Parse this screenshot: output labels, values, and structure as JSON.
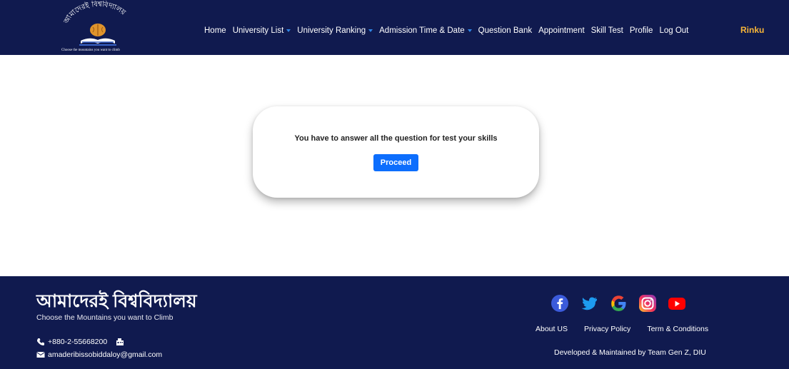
{
  "brand": {
    "logo_text": "আমাদেরই বিশ্ববিদ্যালয়",
    "logo_tagline": "Choose the mountains you want to climb"
  },
  "nav": {
    "items": [
      {
        "label": "Home",
        "dropdown": false
      },
      {
        "label": "University List",
        "dropdown": true
      },
      {
        "label": "University Ranking",
        "dropdown": true
      },
      {
        "label": "Admission Time & Date",
        "dropdown": true
      },
      {
        "label": "Question Bank",
        "dropdown": false
      },
      {
        "label": "Appointment",
        "dropdown": false
      },
      {
        "label": "Skill Test",
        "dropdown": false
      },
      {
        "label": "Profile",
        "dropdown": false
      },
      {
        "label": "Log Out",
        "dropdown": false
      }
    ],
    "user_name": "Rinku"
  },
  "main": {
    "instruction": "You have to answer all the question for test your skills",
    "proceed_label": "Proceed"
  },
  "footer": {
    "brand": "আমাদেরই বিশ্ববিদ্যালয়",
    "tagline": "Choose the Mountains you want to Climb",
    "phone": "+880-2-55668200",
    "email": "amaderibissobiddaloy@gmail.com",
    "social": [
      "facebook-icon",
      "twitter-icon",
      "google-icon",
      "instagram-icon",
      "youtube-icon"
    ],
    "links": [
      "About US",
      "Privacy Policy",
      "Term & Conditions"
    ],
    "credit": "Developed & Maintained by Team Gen Z, DIU"
  },
  "colors": {
    "navy": "#101a4f",
    "accent_blue": "#0d6efd",
    "user_gold": "#f7b538"
  }
}
